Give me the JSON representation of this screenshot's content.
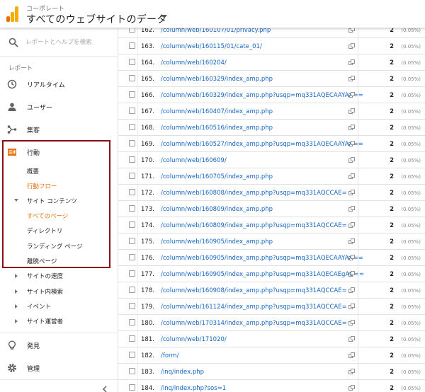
{
  "header": {
    "account": "コーポレート",
    "property": "すべてのウェブサイトのデータ"
  },
  "search": {
    "placeholder": "レポートとヘルプを検索"
  },
  "sidebar": {
    "reports_label": "レポート",
    "realtime": "リアルタイム",
    "users": "ユーザー",
    "acquisition": "集客",
    "behavior": "行動",
    "behavior_sub": {
      "overview": "概要",
      "flow": "行動フロー",
      "site_content": "サイト コンテンツ",
      "all_pages": "すべてのページ",
      "directory": "ディレクトリ",
      "landing_pages": "ランディング ページ",
      "exit_pages": "離脱ページ"
    },
    "site_speed": "サイトの速度",
    "site_search": "サイト内検索",
    "events": "イベント",
    "publisher": "サイト運営者",
    "discover": "発見",
    "admin": "管理"
  },
  "table": {
    "rows": [
      {
        "num": "162.",
        "path": "/column/web/160107/01/privacy.php",
        "value": "2",
        "pct": "(0.05%)"
      },
      {
        "num": "163.",
        "path": "/column/web/160115/01/cate_01/",
        "value": "2",
        "pct": "(0.05%)"
      },
      {
        "num": "164.",
        "path": "/column/web/160204/",
        "value": "2",
        "pct": "(0.05%)"
      },
      {
        "num": "165.",
        "path": "/column/web/160329/index_amp.php",
        "value": "2",
        "pct": "(0.05%)"
      },
      {
        "num": "166.",
        "path": "/column/web/160329/index_amp.php?usqp=mq331AQECAAYAA==",
        "value": "2",
        "pct": "(0.05%)"
      },
      {
        "num": "167.",
        "path": "/column/web/160407/index_amp.php",
        "value": "2",
        "pct": "(0.05%)"
      },
      {
        "num": "168.",
        "path": "/column/web/160516/index_amp.php",
        "value": "2",
        "pct": "(0.05%)"
      },
      {
        "num": "169.",
        "path": "/column/web/160527/index_amp.php?usqp=mq331AQECAAYAA==",
        "value": "2",
        "pct": "(0.05%)"
      },
      {
        "num": "170.",
        "path": "/column/web/160609/",
        "value": "2",
        "pct": "(0.05%)"
      },
      {
        "num": "171.",
        "path": "/column/web/160705/index_amp.php",
        "value": "2",
        "pct": "(0.05%)"
      },
      {
        "num": "172.",
        "path": "/column/web/160808/index_amp.php?usqp=mq331AQCCAE=",
        "value": "2",
        "pct": "(0.05%)"
      },
      {
        "num": "173.",
        "path": "/column/web/160809/index_amp.php",
        "value": "2",
        "pct": "(0.05%)"
      },
      {
        "num": "174.",
        "path": "/column/web/160809/index_amp.php?usqp=mq331AQCCAE=",
        "value": "2",
        "pct": "(0.05%)"
      },
      {
        "num": "175.",
        "path": "/column/web/160905/index_amp.php",
        "value": "2",
        "pct": "(0.05%)"
      },
      {
        "num": "176.",
        "path": "/column/web/160905/index_amp.php?usqp=mq331AQECAAYAA==",
        "value": "2",
        "pct": "(0.05%)"
      },
      {
        "num": "177.",
        "path": "/column/web/160905/index_amp.php?usqp=mq331AQECAEgAQ==",
        "value": "2",
        "pct": "(0.05%)"
      },
      {
        "num": "178.",
        "path": "/column/web/160908/index_amp.php?usqp=mq331AQCCAE=",
        "value": "2",
        "pct": "(0.05%)"
      },
      {
        "num": "179.",
        "path": "/column/web/161124/index_amp.php?usqp=mq331AQCCAE=",
        "value": "2",
        "pct": "(0.05%)"
      },
      {
        "num": "180.",
        "path": "/column/web/170314/index_amp.php?usqp=mq331AQCCAE=",
        "value": "2",
        "pct": "(0.05%)"
      },
      {
        "num": "181.",
        "path": "/column/web/171020/",
        "value": "2",
        "pct": "(0.05%)"
      },
      {
        "num": "182.",
        "path": "/form/",
        "value": "2",
        "pct": "(0.05%)"
      },
      {
        "num": "183.",
        "path": "/inq/index.php",
        "value": "2",
        "pct": "(0.05%)"
      },
      {
        "num": "184.",
        "path": "/inq/index.php?sos=1",
        "value": "2",
        "pct": "(0.05%)"
      }
    ]
  },
  "colors": {
    "active": "#e8710a",
    "link": "#1565c0",
    "highlight_box": "#8b1010",
    "logo_orange": "#f9ab00",
    "logo_dark": "#e37400"
  },
  "icons": [
    "analytics-logo",
    "search-icon",
    "clock-icon",
    "person-icon",
    "acquisition-icon",
    "behavior-icon",
    "lightbulb-icon",
    "gear-icon",
    "popout-icon",
    "collapse-icon"
  ]
}
